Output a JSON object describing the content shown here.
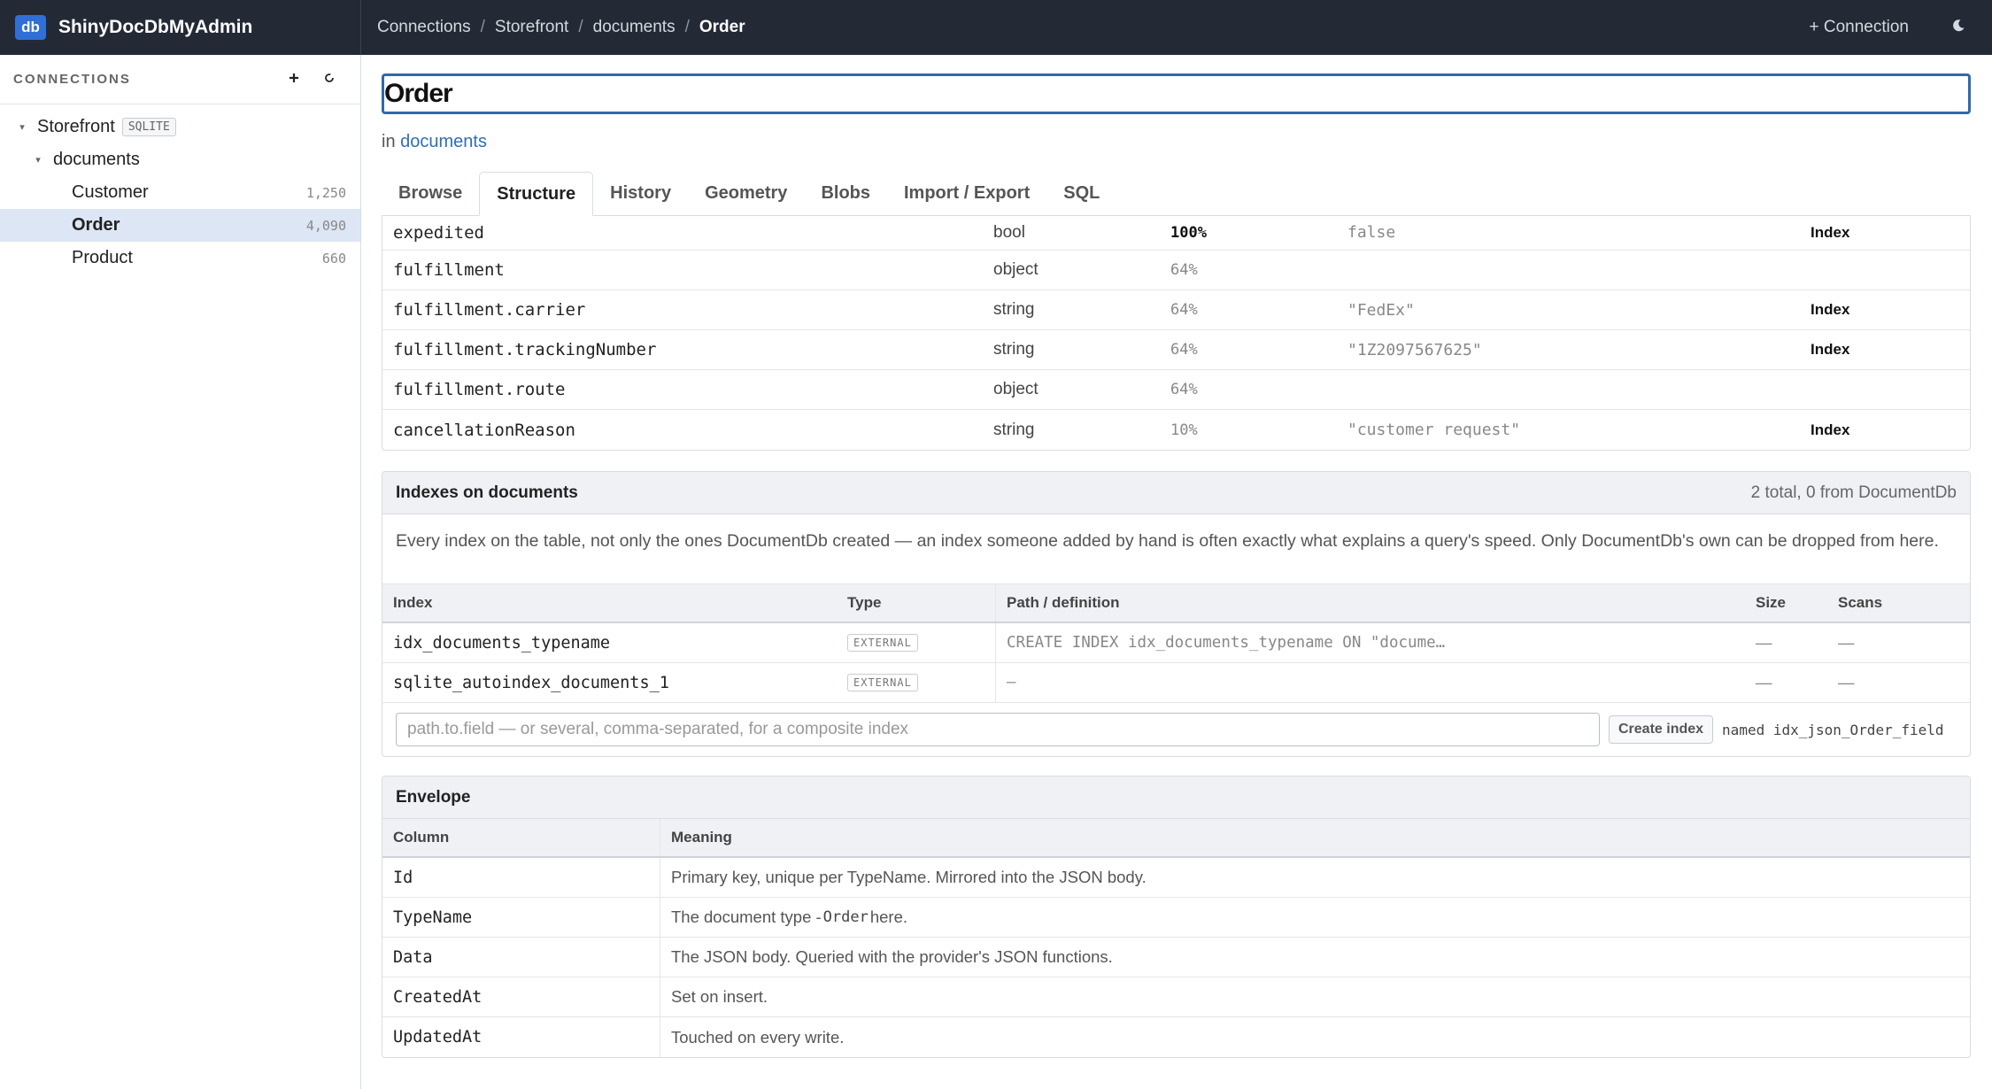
{
  "app": {
    "logo": "db",
    "name": "ShinyDocDbMyAdmin"
  },
  "breadcrumb": [
    "Connections",
    "Storefront",
    "documents",
    "Order"
  ],
  "topbar": {
    "connection_button": "+ Connection",
    "theme_icon": "moon-icon"
  },
  "sidebar": {
    "title": "CONNECTIONS",
    "add_icon": "plus-icon",
    "refresh_icon": "refresh-icon",
    "connection": {
      "name": "Storefront",
      "badge": "SQLITE"
    },
    "table": "documents",
    "types": [
      {
        "name": "Customer",
        "count": "1,250"
      },
      {
        "name": "Order",
        "count": "4,090"
      },
      {
        "name": "Product",
        "count": "660"
      }
    ]
  },
  "main": {
    "title": "Order",
    "in_prefix": "in",
    "in_link": "documents",
    "tabs": [
      "Browse",
      "Structure",
      "History",
      "Geometry",
      "Blobs",
      "Import / Export",
      "SQL"
    ],
    "active_tab": "Structure",
    "fields": [
      {
        "path": "expedited",
        "type": "bool",
        "coverage": "100%",
        "sample": "false",
        "action": "Index"
      },
      {
        "path": "fulfillment",
        "type": "object",
        "coverage": "64%",
        "sample": "",
        "action": ""
      },
      {
        "path": "fulfillment.carrier",
        "type": "string",
        "coverage": "64%",
        "sample": "\"FedEx\"",
        "action": "Index"
      },
      {
        "path": "fulfillment.trackingNumber",
        "type": "string",
        "coverage": "64%",
        "sample": "\"1Z2097567625\"",
        "action": "Index"
      },
      {
        "path": "fulfillment.route",
        "type": "object",
        "coverage": "64%",
        "sample": "",
        "action": ""
      },
      {
        "path": "cancellationReason",
        "type": "string",
        "coverage": "10%",
        "sample": "\"customer request\"",
        "action": "Index"
      }
    ],
    "indexes": {
      "title": "Indexes on documents",
      "summary": "2 total, 0 from DocumentDb",
      "description": "Every index on the table, not only the ones DocumentDb created — an index someone added by hand is often exactly what explains a query's speed. Only DocumentDb's own can be dropped from here.",
      "columns": [
        "Index",
        "Type",
        "Path / definition",
        "Size",
        "Scans"
      ],
      "rows": [
        {
          "name": "idx_documents_typename",
          "type": "EXTERNAL",
          "definition": "CREATE INDEX idx_documents_typename ON \"docume…",
          "size": "—",
          "scans": "—"
        },
        {
          "name": "sqlite_autoindex_documents_1",
          "type": "EXTERNAL",
          "definition": "—",
          "size": "—",
          "scans": "—"
        }
      ],
      "create_placeholder": "path.to.field — or several, comma-separated, for a composite index",
      "create_button": "Create index",
      "named_label": "named idx_json_Order_field"
    },
    "envelope": {
      "title": "Envelope",
      "columns": [
        "Column",
        "Meaning"
      ],
      "rows": [
        {
          "column": "Id",
          "meaning": "Primary key, unique per TypeName. Mirrored into the JSON body."
        },
        {
          "column": "TypeName",
          "meaning_pre": "The document type - ",
          "meaning_code": "Order",
          "meaning_post": " here."
        },
        {
          "column": "Data",
          "meaning": "The JSON body. Queried with the provider's JSON functions."
        },
        {
          "column": "CreatedAt",
          "meaning": "Set on insert."
        },
        {
          "column": "UpdatedAt",
          "meaning": "Touched on every write."
        }
      ]
    }
  }
}
